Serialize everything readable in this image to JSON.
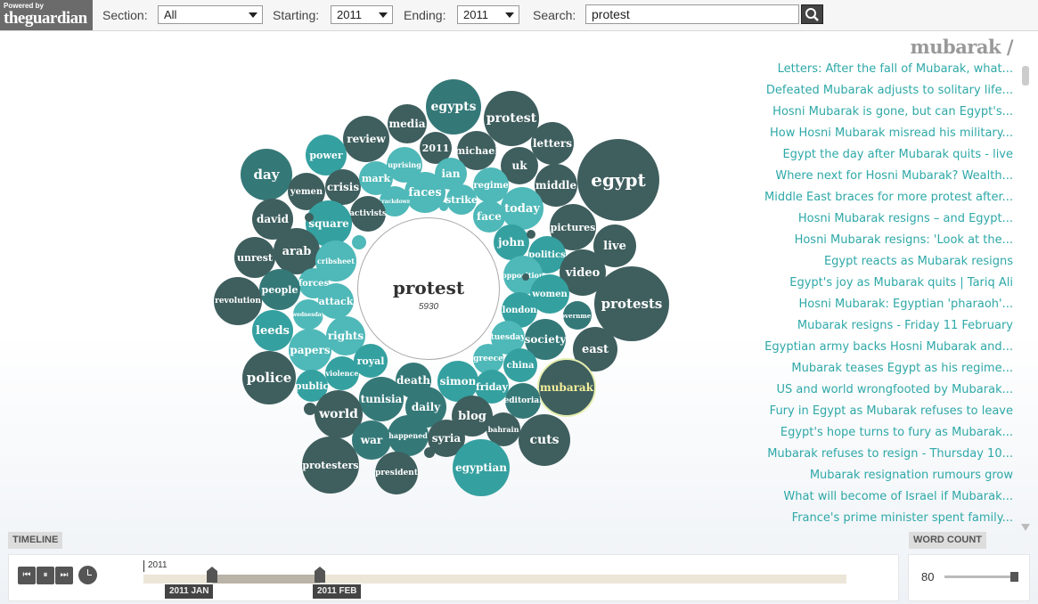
{
  "header": {
    "logo_small": "Powered by",
    "logo_big": "theguardian",
    "section_label": "Section:",
    "section_value": "All",
    "starting_label": "Starting:",
    "starting_value": "2011",
    "ending_label": "Ending:",
    "ending_value": "2011",
    "search_label": "Search:",
    "search_value": "protest"
  },
  "center": {
    "word": "protest",
    "count": "5930"
  },
  "bubble_colors": {
    "dark": "#3f5e5e",
    "mid": "#357878",
    "teal": "#35a0a0",
    "light": "#4fb8b8",
    "selected_text": "#f6f09a"
  },
  "words": [
    {
      "w": "egypts",
      "tone": "mid",
      "fs": 14
    },
    {
      "w": "protest",
      "tone": "dark",
      "fs": 14
    },
    {
      "w": "media",
      "tone": "dark",
      "fs": 12
    },
    {
      "w": "letters",
      "tone": "dark",
      "fs": 12
    },
    {
      "w": "review",
      "tone": "dark",
      "fs": 12
    },
    {
      "w": "2011",
      "tone": "dark",
      "fs": 11
    },
    {
      "w": "michael",
      "tone": "dark",
      "fs": 11
    },
    {
      "w": "power",
      "tone": "teal",
      "fs": 11
    },
    {
      "w": "uk",
      "tone": "dark",
      "fs": 12
    },
    {
      "w": "egypt",
      "tone": "dark",
      "fs": 20
    },
    {
      "w": "day",
      "tone": "mid",
      "fs": 15
    },
    {
      "w": "uprising",
      "tone": "light",
      "fs": 8
    },
    {
      "w": "ian",
      "tone": "light",
      "fs": 12
    },
    {
      "w": "middle",
      "tone": "dark",
      "fs": 12
    },
    {
      "w": "yemen",
      "tone": "dark",
      "fs": 10
    },
    {
      "w": "crisis",
      "tone": "dark",
      "fs": 12
    },
    {
      "w": "mark",
      "tone": "light",
      "fs": 11
    },
    {
      "w": "faces",
      "tone": "light",
      "fs": 13
    },
    {
      "w": "regime",
      "tone": "light",
      "fs": 10
    },
    {
      "w": "strike",
      "tone": "light",
      "fs": 11
    },
    {
      "w": "crackdown",
      "tone": "light",
      "fs": 6
    },
    {
      "w": "activists",
      "tone": "dark",
      "fs": 9
    },
    {
      "w": "today",
      "tone": "light",
      "fs": 13
    },
    {
      "w": "face",
      "tone": "light",
      "fs": 12
    },
    {
      "w": "david",
      "tone": "dark",
      "fs": 12
    },
    {
      "w": "square",
      "tone": "teal",
      "fs": 12
    },
    {
      "w": "pictures",
      "tone": "dark",
      "fs": 11
    },
    {
      "w": "john",
      "tone": "teal",
      "fs": 12
    },
    {
      "w": "live",
      "tone": "dark",
      "fs": 13
    },
    {
      "w": "unrest",
      "tone": "dark",
      "fs": 11
    },
    {
      "w": "arab",
      "tone": "dark",
      "fs": 13
    },
    {
      "w": "politics",
      "tone": "teal",
      "fs": 10
    },
    {
      "w": "cribsheet",
      "tone": "light",
      "fs": 8
    },
    {
      "w": "video",
      "tone": "dark",
      "fs": 13
    },
    {
      "w": "opposition",
      "tone": "light",
      "fs": 8
    },
    {
      "w": "protests",
      "tone": "dark",
      "fs": 15
    },
    {
      "w": "forces",
      "tone": "light",
      "fs": 10
    },
    {
      "w": "people",
      "tone": "mid",
      "fs": 11
    },
    {
      "w": "revolution",
      "tone": "dark",
      "fs": 9
    },
    {
      "w": "attack",
      "tone": "light",
      "fs": 11
    },
    {
      "w": "women",
      "tone": "teal",
      "fs": 10
    },
    {
      "w": "london",
      "tone": "teal",
      "fs": 10
    },
    {
      "w": "government",
      "tone": "mid",
      "fs": 7
    },
    {
      "w": "wednesday",
      "tone": "light",
      "fs": 6
    },
    {
      "w": "leeds",
      "tone": "teal",
      "fs": 13
    },
    {
      "w": "tuesday",
      "tone": "light",
      "fs": 9
    },
    {
      "w": "society",
      "tone": "mid",
      "fs": 12
    },
    {
      "w": "rights",
      "tone": "light",
      "fs": 12
    },
    {
      "w": "east",
      "tone": "dark",
      "fs": 13
    },
    {
      "w": "papers",
      "tone": "light",
      "fs": 12
    },
    {
      "w": "royal",
      "tone": "teal",
      "fs": 11
    },
    {
      "w": "greece",
      "tone": "light",
      "fs": 9
    },
    {
      "w": "china",
      "tone": "teal",
      "fs": 10
    },
    {
      "w": "police",
      "tone": "dark",
      "fs": 15
    },
    {
      "w": "violence",
      "tone": "teal",
      "fs": 8
    },
    {
      "w": "death",
      "tone": "mid",
      "fs": 12
    },
    {
      "w": "simon",
      "tone": "teal",
      "fs": 12
    },
    {
      "w": "mubarak",
      "tone": "dark",
      "fs": 12
    },
    {
      "w": "public",
      "tone": "teal",
      "fs": 11
    },
    {
      "w": "friday",
      "tone": "teal",
      "fs": 11
    },
    {
      "w": "tunisia",
      "tone": "mid",
      "fs": 12
    },
    {
      "w": "editorial",
      "tone": "mid",
      "fs": 9
    },
    {
      "w": "daily",
      "tone": "mid",
      "fs": 12
    },
    {
      "w": "world",
      "tone": "dark",
      "fs": 14
    },
    {
      "w": "blog",
      "tone": "dark",
      "fs": 13
    },
    {
      "w": "bahrain",
      "tone": "dark",
      "fs": 8
    },
    {
      "w": "cuts",
      "tone": "dark",
      "fs": 14
    },
    {
      "w": "war",
      "tone": "mid",
      "fs": 12
    },
    {
      "w": "happened",
      "tone": "mid",
      "fs": 8
    },
    {
      "w": "syria",
      "tone": "dark",
      "fs": 12
    },
    {
      "w": "protesters",
      "tone": "dark",
      "fs": 11
    },
    {
      "w": "egyptian",
      "tone": "teal",
      "fs": 12
    },
    {
      "w": "president",
      "tone": "dark",
      "fs": 9
    },
    {
      "w": "",
      "tone": "light",
      "fs": 8
    },
    {
      "w": "",
      "tone": "dark",
      "fs": 8
    },
    {
      "w": "",
      "tone": "dark",
      "fs": 8
    },
    {
      "w": "",
      "tone": "light",
      "fs": 8
    },
    {
      "w": "",
      "tone": "dark",
      "fs": 8
    },
    {
      "w": "",
      "tone": "dark",
      "fs": 8
    },
    {
      "w": "",
      "tone": "dark",
      "fs": 8
    }
  ],
  "articles_title": "mubarak /",
  "articles": [
    "Letters: After the fall of Mubarak, what...",
    "Defeated Mubarak adjusts to solitary life...",
    "Hosni Mubarak is gone, but can Egypt's...",
    "How Hosni Mubarak misread his military...",
    "Egypt the day after Mubarak quits - live",
    "Where next for Hosni Mubarak? Wealth...",
    "Middle East braces for more protest after...",
    "Hosni Mubarak resigns – and Egypt...",
    "Hosni Mubarak resigns: 'Look at the...",
    "Egypt reacts as Mubarak resigns",
    "Egypt's joy as Mubarak quits | Tariq Ali",
    "Hosni Mubarak: Egyptian 'pharaoh'...",
    "Mubarak resigns - Friday 11 February",
    "Egyptian army backs Hosni Mubarak and...",
    "Mubarak teases Egypt as his regime...",
    "US and world wrongfooted by Mubarak...",
    "Fury in Egypt as Mubarak refuses to leave",
    "Egypt's hope turns to fury as Mubarak...",
    "Mubarak refuses to resign - Thursday 10...",
    "Mubarak resignation rumours grow",
    "What will become of Israel if Mubarak...",
    "France's prime minister spent family..."
  ],
  "timeline": {
    "label": "TIMELINE",
    "year": "2011",
    "start_label": "2011 JAN",
    "end_label": "2011 FEB",
    "prev": "⏮",
    "pause": "⏸",
    "next": "⏭"
  },
  "word_count": {
    "label": "WORD COUNT",
    "value": "80"
  }
}
